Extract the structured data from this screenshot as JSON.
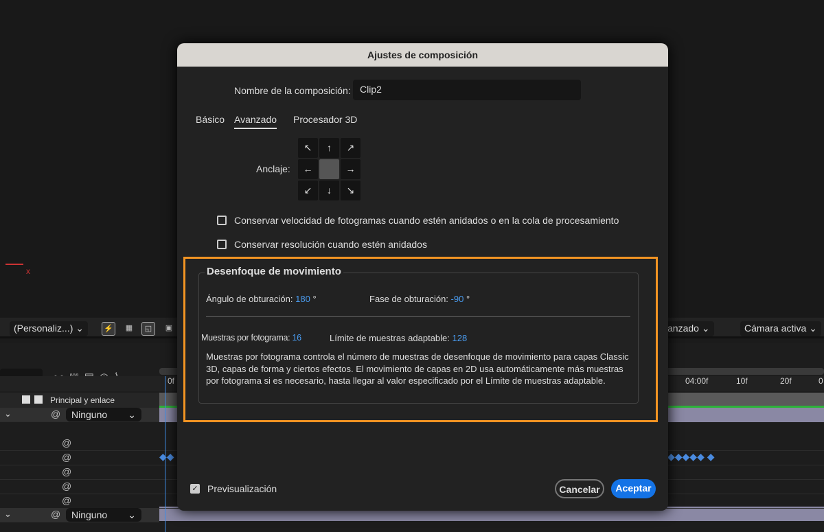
{
  "dialog": {
    "title": "Ajustes de composición",
    "comp_name_label": "Nombre de la composición:",
    "comp_name_value": "Clip2",
    "tabs": [
      "Básico",
      "Avanzado",
      "Procesador 3D"
    ],
    "anchor_label": "Anclaje:",
    "anchor_arrows": [
      "↖",
      "↑",
      "↗",
      "←",
      "",
      "→",
      "↙",
      "↓",
      "↘"
    ],
    "checkbox_framerate": "Conservar velocidad de fotogramas cuando estén anidados o en la cola de procesamiento",
    "checkbox_resolution": "Conservar resolución cuando estén anidados",
    "motion_blur": {
      "title": "Desenfoque de movimiento",
      "shutter_angle_label": "Ángulo de obturación:",
      "shutter_angle_value": "180",
      "shutter_phase_label": "Fase de obturación:",
      "shutter_phase_value": "-90",
      "degree": "°",
      "samples_label": "Muestras por fotograma:",
      "samples_value": "16",
      "limit_label": "Límite de muestras adaptable:",
      "limit_value": "128",
      "description": "Muestras por fotograma controla el número de muestras de desenfoque de movimiento para capas Classic 3D, capas de forma y ciertos efectos. El movimiento de capas en 2D usa automáticamente más muestras por fotograma si es necesario, hasta llegar al valor especificado por el Límite de muestras adaptable."
    },
    "preview_label": "Previsualización",
    "cancel": "Cancelar",
    "ok": "Aceptar"
  },
  "toolbar": {
    "view_select": "(Personaliz...)",
    "renderer_select": "anzado",
    "camera_select": "Cámara activa"
  },
  "timeline": {
    "parent_header": "Principal y enlace",
    "parent_value": "Ninguno",
    "ruler": [
      "0f",
      "04:00f",
      "10f",
      "20f",
      "0"
    ]
  },
  "colors": {
    "accent": "#1473e6",
    "highlight": "#f29423"
  }
}
